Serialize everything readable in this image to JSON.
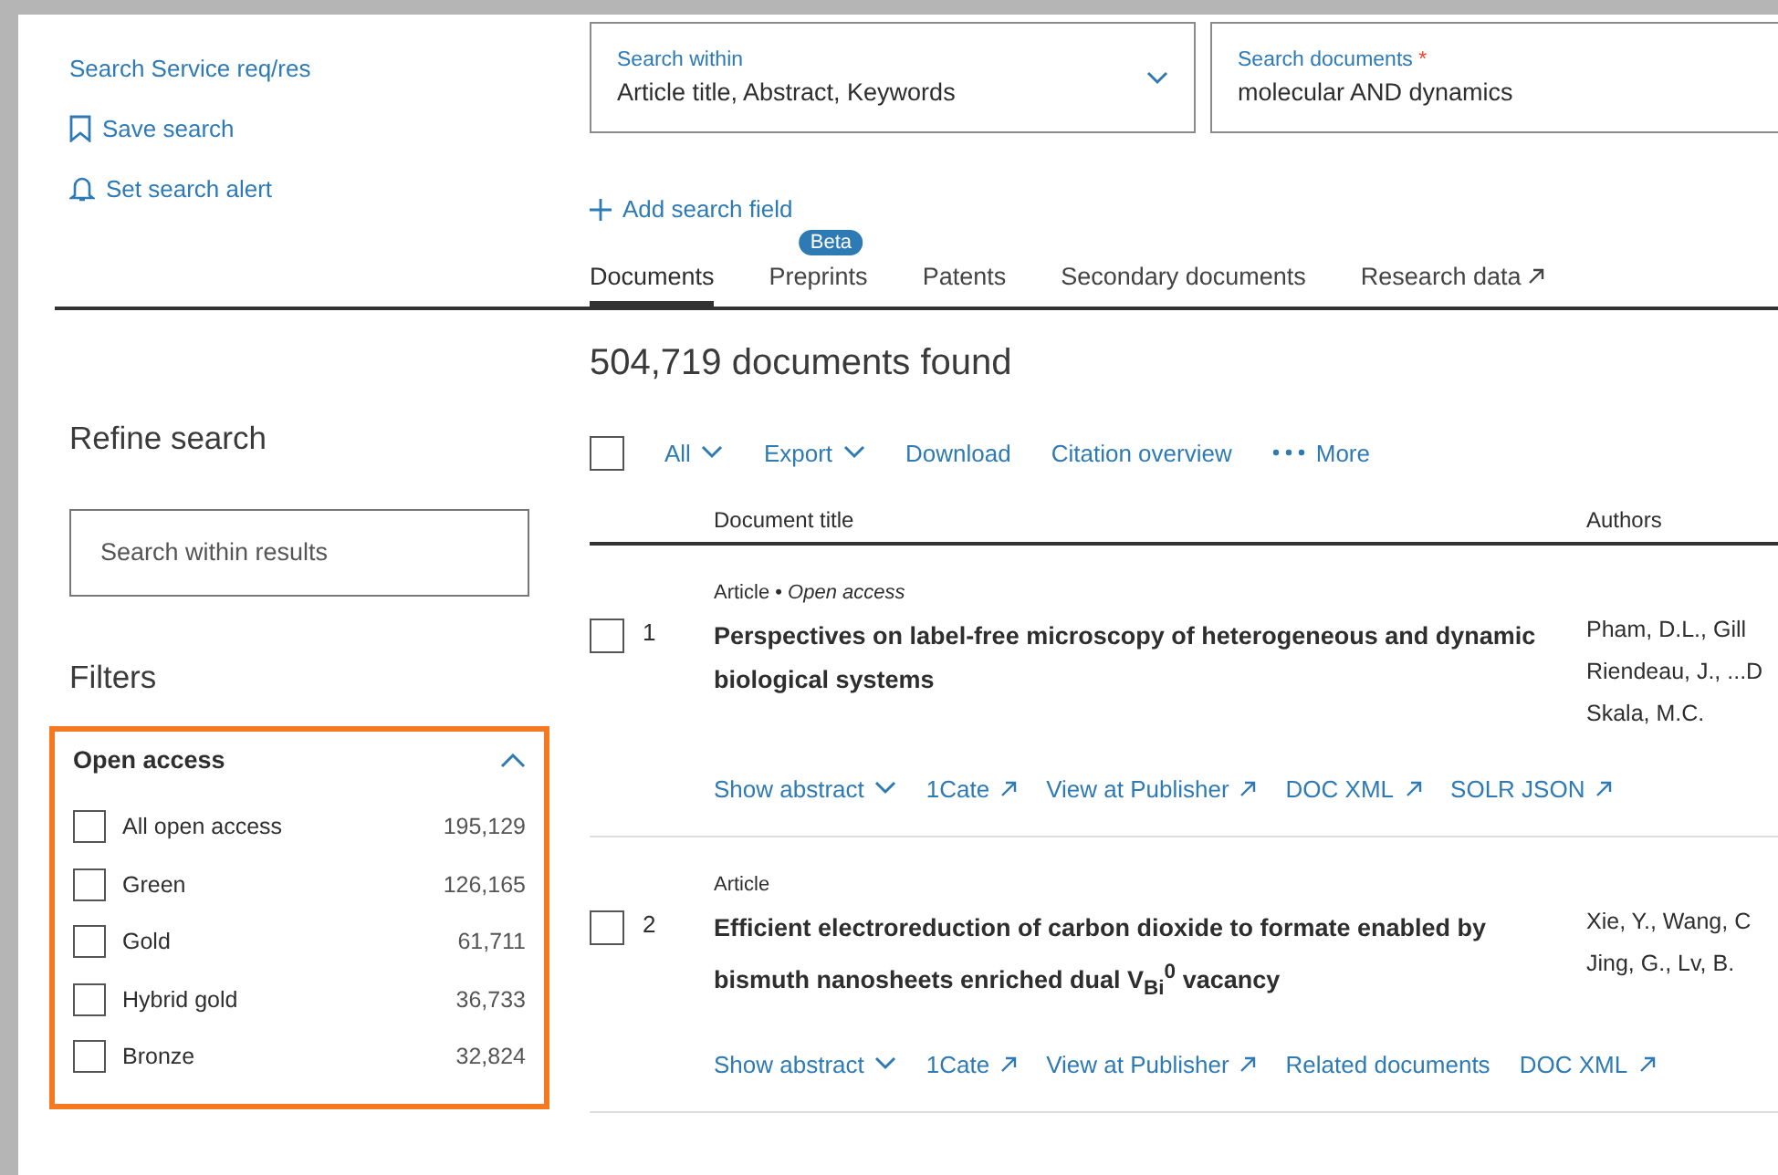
{
  "sidebar_links": [
    {
      "label": "Search Service req/res",
      "kind": "plain"
    },
    {
      "label": "Save search",
      "kind": "bookmark"
    },
    {
      "label": "Set search alert",
      "kind": "alert"
    }
  ],
  "search_within": {
    "label": "Search within",
    "value": "Article title, Abstract, Keywords"
  },
  "search_documents": {
    "label": "Search documents",
    "required_mark": "*",
    "value": "molecular AND dynamics"
  },
  "add_field": "Add search field",
  "tabs": [
    {
      "label": "Documents",
      "selected": true
    },
    {
      "label": "Preprints",
      "selected": false,
      "badge": "Beta"
    },
    {
      "label": "Patents",
      "selected": false
    },
    {
      "label": "Secondary documents",
      "selected": false
    },
    {
      "label": "Research data",
      "selected": false,
      "kind": "external"
    }
  ],
  "refine": {
    "title": "Refine search",
    "placeholder": "Search within results",
    "filters_title": "Filters"
  },
  "open_access": {
    "title": "Open access",
    "expanded": true,
    "options": [
      {
        "label": "All open access",
        "count": "195,129",
        "checked": false
      },
      {
        "label": "Green",
        "count": "126,165",
        "checked": false
      },
      {
        "label": "Gold",
        "count": "61,711",
        "checked": false
      },
      {
        "label": "Hybrid gold",
        "count": "36,733",
        "checked": false
      },
      {
        "label": "Bronze",
        "count": "32,824",
        "checked": false
      }
    ]
  },
  "results_count": "504,719 documents found",
  "toolbar": {
    "select_all_checked": false,
    "actions": [
      {
        "label": "All",
        "kind": "dropdown"
      },
      {
        "label": "Export",
        "kind": "dropdown"
      },
      {
        "label": "Download",
        "kind": "plain"
      },
      {
        "label": "Citation overview",
        "kind": "plain"
      },
      {
        "label": "More",
        "kind": "more"
      }
    ]
  },
  "columns": [
    "Document title",
    "Authors"
  ],
  "results": [
    {
      "number": "1",
      "checked": false,
      "meta": "Article • *Open access*",
      "title": "Perspectives on label-free microscopy of heterogeneous and dynamic biological systems",
      "authors": [
        "Pham, D.L., Gill",
        "Riendeau, J., ...D",
        "Skala, M.C."
      ],
      "actions": [
        {
          "label": "Show abstract",
          "kind": "dropdown"
        },
        {
          "label": "1Cate",
          "kind": "external"
        },
        {
          "label": "View at Publisher",
          "kind": "external"
        },
        {
          "label": "DOC XML",
          "kind": "external"
        },
        {
          "label": "SOLR JSON",
          "kind": "external"
        }
      ]
    },
    {
      "number": "2",
      "checked": false,
      "meta": "Article",
      "title": "Efficient electroreduction of carbon dioxide to formate enabled by bismuth nanosheets enriched dual V$_{Bi}$$^{0}$ vacancy",
      "authors": [
        "Xie, Y., Wang, C",
        "Jing, G., Lv, B."
      ],
      "actions": [
        {
          "label": "Show abstract",
          "kind": "dropdown"
        },
        {
          "label": "1Cate",
          "kind": "external"
        },
        {
          "label": "View at Publisher",
          "kind": "external"
        },
        {
          "label": "Related documents",
          "kind": "plain"
        },
        {
          "label": "DOC XML",
          "kind": "external"
        }
      ]
    }
  ]
}
